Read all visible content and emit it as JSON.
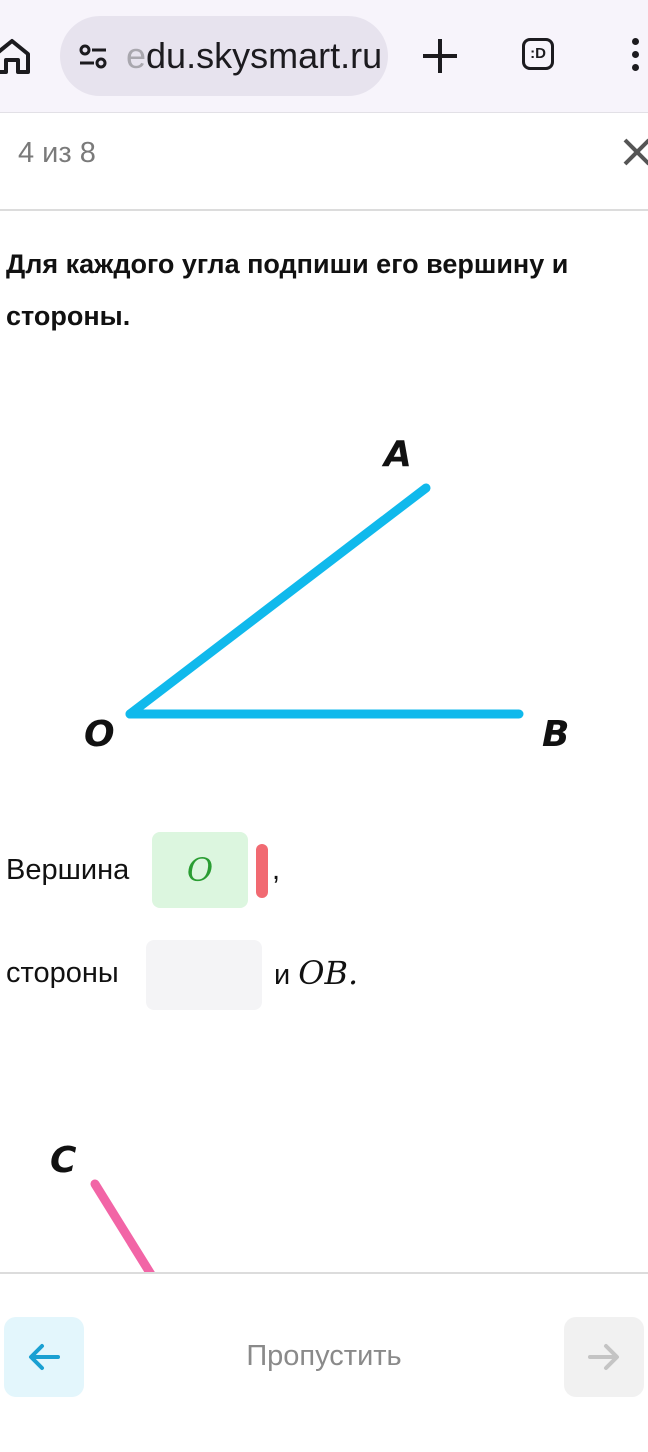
{
  "browser": {
    "url_faded": "e",
    "url": "du.skysmart.ru",
    "tabs_icon_label": ":D",
    "icons": [
      "home-icon",
      "site-settings-icon",
      "plus-icon",
      "tabs-icon",
      "more-vert-icon"
    ]
  },
  "progress": {
    "text": "4 из 8",
    "close_icon": "close-icon"
  },
  "task": {
    "title": "Для каждого угла подпиши его вершину и стороны."
  },
  "figure1": {
    "labels": {
      "a": "A",
      "o": "O",
      "b": "B"
    },
    "color": "#10b9ec"
  },
  "answer": {
    "vertex_label": "Вершина",
    "vertex_value": "O",
    "vertex_status_color": "#f16a72",
    "vertex_suffix": ",",
    "sides_label": "стороны",
    "sides_value": "",
    "sides_and": "и",
    "sides_known": "OB."
  },
  "figure2": {
    "label_c": "C",
    "color": "#f265a6"
  },
  "nav": {
    "skip_label": "Пропустить",
    "back_icon": "arrow-left-icon",
    "next_icon": "arrow-right-icon",
    "accent": "#1aa0d2"
  }
}
